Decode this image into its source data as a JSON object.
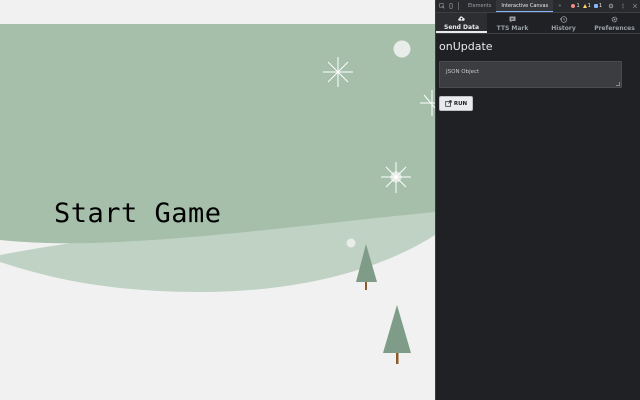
{
  "game": {
    "start_label": "Start Game",
    "colors": {
      "sky": "#a5bfaa",
      "hill": "#bfd2c4",
      "snow": "#f1f1f1",
      "tree": "#7e9c88",
      "trunk": "#8b5a2b",
      "flake": "#ffffff"
    }
  },
  "devtools": {
    "toolbar": {
      "tabs": [
        "Elements",
        "Interactive Canvas"
      ],
      "active_tab": "Interactive Canvas",
      "more": "»",
      "errors": "1",
      "warnings": "1",
      "info": "1"
    },
    "ext_tabs": [
      {
        "label": "Send Data",
        "icon": "cloud-upload-icon"
      },
      {
        "label": "TTS Mark",
        "icon": "comment-icon"
      },
      {
        "label": "History",
        "icon": "history-icon"
      },
      {
        "label": "Preferences",
        "icon": "gear-icon"
      }
    ],
    "active_ext_tab": "Send Data",
    "event_title": "onUpdate",
    "json_placeholder": "JSON Object",
    "run_label": "RUN"
  }
}
